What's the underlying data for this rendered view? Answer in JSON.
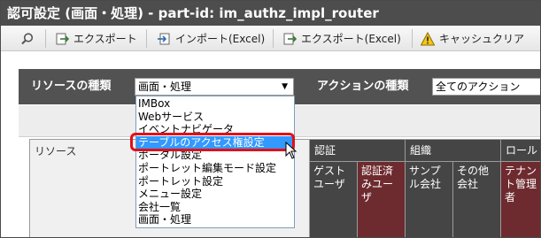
{
  "window": {
    "title": "認可設定 (画面・処理) - part-id: im_authz_impl_router"
  },
  "toolbar": {
    "items": [
      {
        "icon": "search-icon",
        "label": ""
      },
      {
        "icon": "export-icon",
        "label": "エクスポート"
      },
      {
        "icon": "import-excel-icon",
        "label": "インポート(Excel)"
      },
      {
        "icon": "export-excel-icon",
        "label": "エクスポート(Excel)"
      },
      {
        "icon": "warning-icon",
        "label": "キャッシュクリア"
      }
    ]
  },
  "selectors": {
    "resource_label": "リソースの種類",
    "resource_value": "画面・処理",
    "action_label": "アクションの種類",
    "action_value": "全てのアクション"
  },
  "table": {
    "resource_header": "リソース",
    "groups": [
      "認証",
      "組織",
      "ロール"
    ],
    "subheaders": [
      "ゲスト ユーザ",
      "認証済 みユー ザ",
      "サンプ ル会社",
      "その他 会社",
      "テナン ト管理 者"
    ]
  },
  "dropdown": {
    "options": [
      "IMBox",
      "Webサービス",
      "イベントナビゲータ",
      "テーブルのアクセス権設定",
      "ポータル設定",
      "ポートレット編集モード設定",
      "ポートレット設定",
      "メニュー設定",
      "会社一覧",
      "画面・処理"
    ],
    "highlighted_index": 3
  },
  "colors": {
    "title_bar": "#4d4d4d",
    "selector_bar": "#525252",
    "header_dark": "#454545",
    "header_red": "#6e2b2f",
    "highlight": "#3399ff",
    "annotation_ring": "#e0101a"
  }
}
